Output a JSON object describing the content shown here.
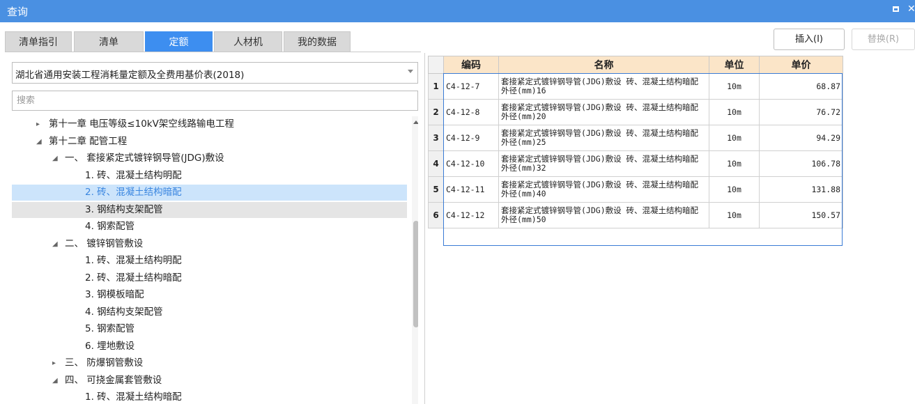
{
  "window": {
    "title": "查询"
  },
  "tabs": [
    {
      "label": "清单指引",
      "active": false
    },
    {
      "label": "清单",
      "active": false
    },
    {
      "label": "定额",
      "active": true
    },
    {
      "label": "人材机",
      "active": false
    },
    {
      "label": "我的数据",
      "active": false
    }
  ],
  "toolbar": {
    "insert_label": "插入(I)",
    "replace_label": "替换(R)"
  },
  "library": {
    "selected": "湖北省通用安装工程消耗量定额及全费用基价表(2018)"
  },
  "search": {
    "placeholder": "搜索"
  },
  "tree": [
    {
      "label": "第十一章 电压等级≤10kV架空线路输电工程",
      "caret": "▸",
      "state": ""
    },
    {
      "label": "第十二章 配管工程",
      "caret": "◢",
      "state": ""
    },
    {
      "label": "一、 套接紧定式镀锌钢导管(JDG)敷设",
      "caret": "◢",
      "state": ""
    },
    {
      "label": "1. 砖、混凝土结构明配",
      "caret": "",
      "state": ""
    },
    {
      "label": "2. 砖、混凝土结构暗配",
      "caret": "",
      "state": "selected"
    },
    {
      "label": "3. 钢结构支架配管",
      "caret": "",
      "state": "hover"
    },
    {
      "label": "4. 钢索配管",
      "caret": "",
      "state": ""
    },
    {
      "label": "二、 镀锌钢管敷设",
      "caret": "◢",
      "state": ""
    },
    {
      "label": "1. 砖、混凝土结构明配",
      "caret": "",
      "state": ""
    },
    {
      "label": "2. 砖、混凝土结构暗配",
      "caret": "",
      "state": ""
    },
    {
      "label": "3. 钢模板暗配",
      "caret": "",
      "state": ""
    },
    {
      "label": "4. 钢结构支架配管",
      "caret": "",
      "state": ""
    },
    {
      "label": "5. 钢索配管",
      "caret": "",
      "state": ""
    },
    {
      "label": "6. 埋地敷设",
      "caret": "",
      "state": ""
    },
    {
      "label": "三、 防爆钢管敷设",
      "caret": "▸",
      "state": ""
    },
    {
      "label": "四、 可挠金属套管敷设",
      "caret": "◢",
      "state": ""
    },
    {
      "label": "1. 砖、混凝土结构暗配",
      "caret": "",
      "state": ""
    }
  ],
  "grid": {
    "headers": [
      "编码",
      "名称",
      "单位",
      "单价"
    ],
    "rows": [
      {
        "no": "1",
        "code": "C4-12-7",
        "name": "套接紧定式镀锌钢导管(JDG)敷设 砖、混凝土结构暗配 外径(mm)16",
        "unit": "10m",
        "price": "68.87"
      },
      {
        "no": "2",
        "code": "C4-12-8",
        "name": "套接紧定式镀锌钢导管(JDG)敷设 砖、混凝土结构暗配 外径(mm)20",
        "unit": "10m",
        "price": "76.72"
      },
      {
        "no": "3",
        "code": "C4-12-9",
        "name": "套接紧定式镀锌钢导管(JDG)敷设 砖、混凝土结构暗配 外径(mm)25",
        "unit": "10m",
        "price": "94.29"
      },
      {
        "no": "4",
        "code": "C4-12-10",
        "name": "套接紧定式镀锌钢导管(JDG)敷设 砖、混凝土结构暗配 外径(mm)32",
        "unit": "10m",
        "price": "106.78"
      },
      {
        "no": "5",
        "code": "C4-12-11",
        "name": "套接紧定式镀锌钢导管(JDG)敷设 砖、混凝土结构暗配 外径(mm)40",
        "unit": "10m",
        "price": "131.88"
      },
      {
        "no": "6",
        "code": "C4-12-12",
        "name": "套接紧定式镀锌钢导管(JDG)敷设 砖、混凝土结构暗配 外径(mm)50",
        "unit": "10m",
        "price": "150.57"
      }
    ]
  },
  "colors": {
    "titlebar": "#4a90e2",
    "active_tab": "#3d8ef0",
    "header_bg": "#fbe5c8",
    "selected_row": "#cce4fb"
  }
}
